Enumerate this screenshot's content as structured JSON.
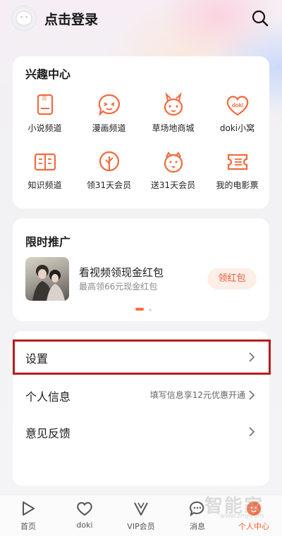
{
  "header": {
    "login_text": "点击登录"
  },
  "interest": {
    "title": "兴趣中心",
    "items": [
      {
        "label": "小说频道",
        "icon": "book-icon"
      },
      {
        "label": "漫画频道",
        "icon": "comic-face-icon"
      },
      {
        "label": "草场地商城",
        "icon": "bunny-icon"
      },
      {
        "label": "doki小窝",
        "icon": "doki-heart-icon"
      },
      {
        "label": "知识频道",
        "icon": "open-book-icon"
      },
      {
        "label": "领31天会员",
        "icon": "tree-icon"
      },
      {
        "label": "送31天会员",
        "icon": "gift-face-icon"
      },
      {
        "label": "我的电影票",
        "icon": "ticket-icon"
      }
    ]
  },
  "promo": {
    "title": "限时推广",
    "item_title": "看视频领现金红包",
    "item_sub": "最高领66元现金红包",
    "button": "领红包"
  },
  "menu": {
    "settings": "设置",
    "profile": "个人信息",
    "profile_hint": "填写信息享12元优惠开通",
    "feedback": "意见反馈"
  },
  "tabs": [
    {
      "label": "首页",
      "icon": "home-play-icon"
    },
    {
      "label": "doki",
      "icon": "doki-heart-icon"
    },
    {
      "label": "VIP会员",
      "icon": "vip-v-icon"
    },
    {
      "label": "消息",
      "icon": "message-bubble-icon"
    },
    {
      "label": "个人中心",
      "icon": "profile-icon",
      "active": true
    }
  ],
  "colors": {
    "accent": "#ff5a2a",
    "icon_orange": "#f26a3d",
    "highlight_border": "#b71c1c"
  },
  "watermark": {
    "text": "智能家",
    "url": "www.zmj.com"
  }
}
